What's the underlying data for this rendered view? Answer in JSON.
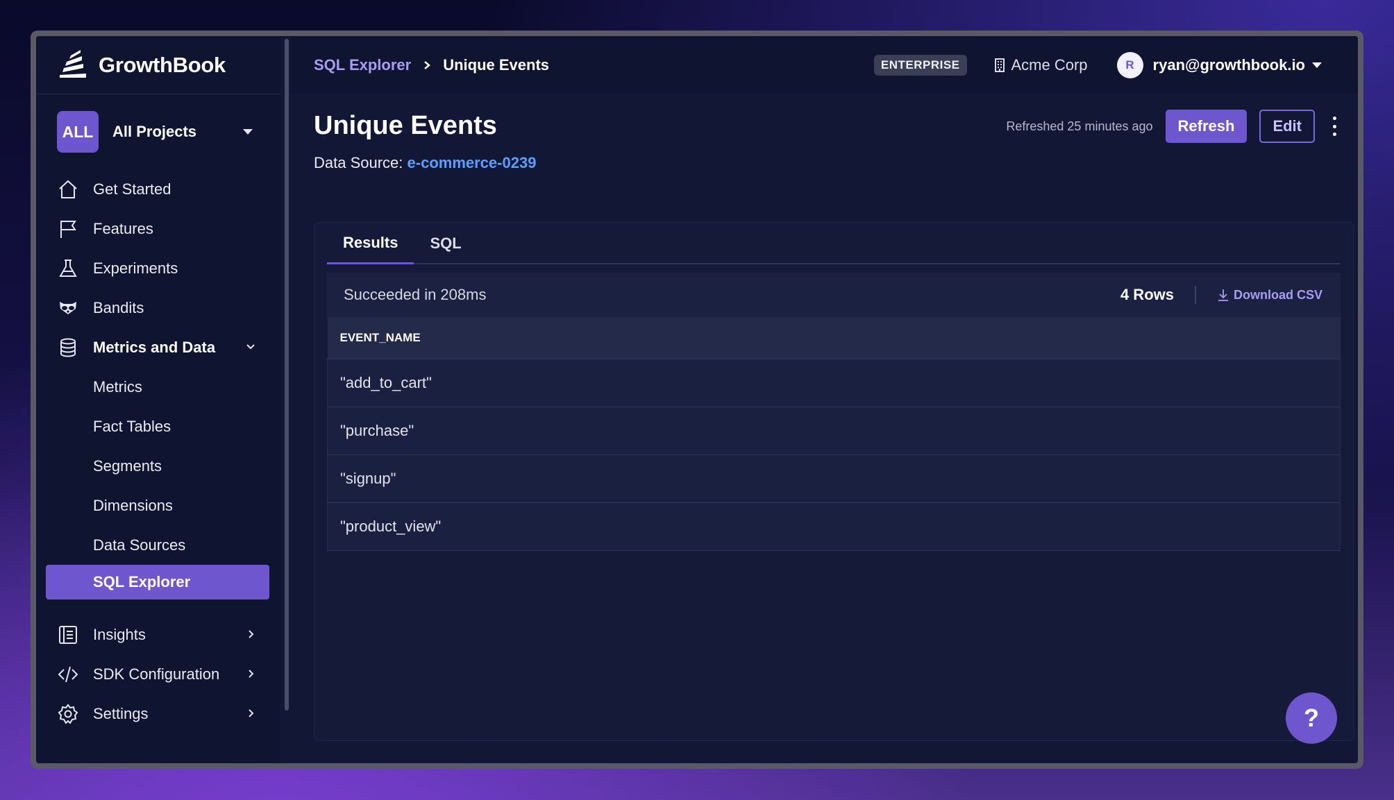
{
  "brand": {
    "name": "GrowthBook"
  },
  "project": {
    "badge": "ALL",
    "name": "All Projects"
  },
  "sidebar": {
    "items": [
      {
        "label": "Get Started",
        "icon": "home-icon"
      },
      {
        "label": "Features",
        "icon": "flag-icon"
      },
      {
        "label": "Experiments",
        "icon": "flask-icon"
      },
      {
        "label": "Bandits",
        "icon": "raccoon-icon"
      },
      {
        "label": "Metrics and Data",
        "icon": "database-icon"
      }
    ],
    "sub_items": [
      "Metrics",
      "Fact Tables",
      "Segments",
      "Dimensions",
      "Data Sources",
      "SQL Explorer"
    ],
    "bottom_items": [
      {
        "label": "Insights",
        "icon": "notebook-icon"
      },
      {
        "label": "SDK Configuration",
        "icon": "code-icon"
      },
      {
        "label": "Settings",
        "icon": "gear-icon"
      }
    ]
  },
  "topbar": {
    "breadcrumb_parent": "SQL Explorer",
    "breadcrumb_current": "Unique Events",
    "plan_badge": "ENTERPRISE",
    "org_name": "Acme Corp",
    "avatar_initial": "R",
    "user_email": "ryan@growthbook.io"
  },
  "page": {
    "title": "Unique Events",
    "data_source_label": "Data Source:",
    "data_source_name": "e-commerce-0239",
    "refreshed": "Refreshed 25 minutes ago",
    "refresh_label": "Refresh",
    "edit_label": "Edit"
  },
  "tabs": [
    "Results",
    "SQL"
  ],
  "results": {
    "status": "Succeeded in 208ms",
    "rows_count": "4 Rows",
    "download_label": "Download CSV",
    "columns": [
      "EVENT_NAME"
    ],
    "rows": [
      "\"add_to_cart\"",
      "\"purchase\"",
      "\"signup\"",
      "\"product_view\""
    ]
  },
  "help": {
    "label": "?"
  },
  "colors": {
    "accent": "#6e56cf",
    "link": "#5aa0ff",
    "background": "#111735"
  }
}
